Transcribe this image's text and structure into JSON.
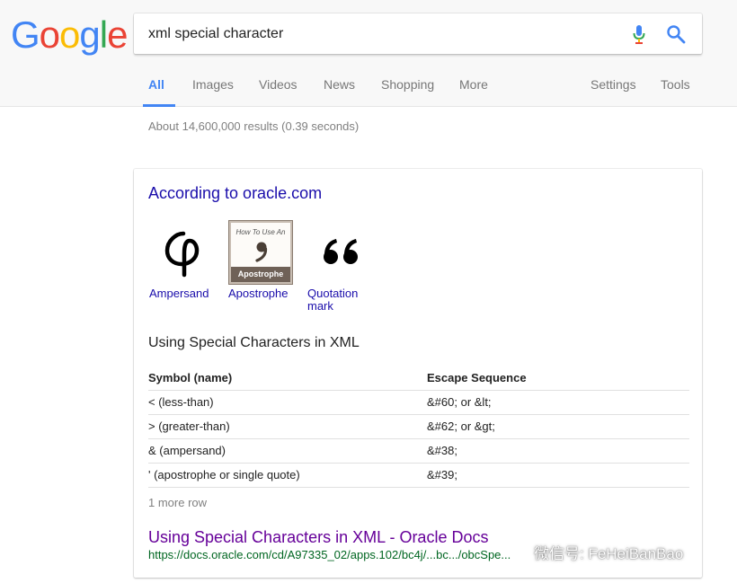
{
  "logo": {
    "letters": [
      "G",
      "o",
      "o",
      "g",
      "l",
      "e"
    ]
  },
  "search": {
    "query": "xml special character"
  },
  "tabs": [
    {
      "label": "All"
    },
    {
      "label": "Images"
    },
    {
      "label": "Videos"
    },
    {
      "label": "News"
    },
    {
      "label": "Shopping"
    },
    {
      "label": "More"
    },
    {
      "label": "Settings"
    },
    {
      "label": "Tools"
    }
  ],
  "stats": "About 14,600,000 results (0.39 seconds)",
  "card": {
    "source": "According to oracle.com",
    "thumbs": [
      {
        "label": "Ampersand",
        "icon": "ampersand-glyph"
      },
      {
        "label": "Apostrophe",
        "icon": "apostrophe-graphic",
        "caption_top": "How To Use An",
        "caption_bottom": "Apostrophe"
      },
      {
        "label_line1": "Quotation",
        "label_line2": "mark",
        "icon": "quotation-mark-glyph"
      }
    ],
    "subtitle": "Using Special Characters in XML",
    "table": {
      "headers": [
        "Symbol (name)",
        "Escape Sequence"
      ],
      "rows": [
        [
          "< (less-than)",
          "&#60; or &lt;"
        ],
        [
          "> (greater-than)",
          "&#62; or &gt;"
        ],
        [
          "& (ampersand)",
          "&#38;"
        ],
        [
          "' (apostrophe or single quote)",
          "&#39;"
        ]
      ]
    },
    "more_row": "1 more row",
    "result_title": "Using Special Characters in XML - Oracle Docs",
    "result_url": "https://docs.oracle.com/cd/A97335_02/apps.102/bc4j/...bc.../obcSpe..."
  },
  "watermark": "微信号: FeHeiBanBao",
  "colors": {
    "link": "#1a0dab",
    "visited": "#660099",
    "url": "#006621",
    "accent": "#4285f4"
  }
}
